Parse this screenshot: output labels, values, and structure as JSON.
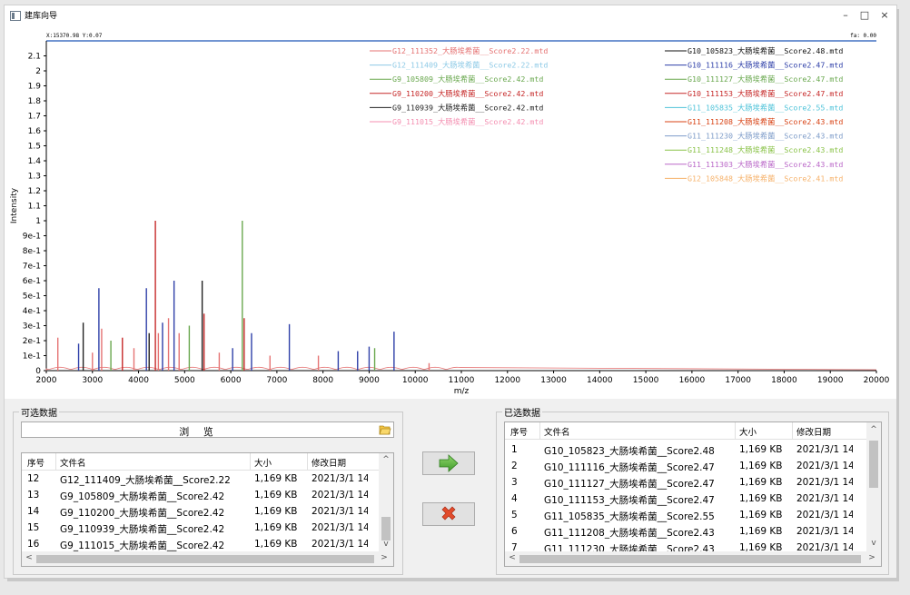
{
  "window": {
    "title": "建库向导",
    "minimize": "–",
    "maximize": "□",
    "close": "×"
  },
  "plot": {
    "cursor_readout": "X:15370.98 Y:0.07",
    "fa_readout": "fa: 0.00",
    "xlabel": "m/z",
    "ylabel": "Intensity",
    "colors": {
      "blue": "#2e3fa8",
      "red": "#c62828",
      "pink": "#e57373",
      "green": "#6aa84f",
      "black": "#222222",
      "axis": "#4472c4"
    }
  },
  "chart_data": {
    "type": "line",
    "title": "",
    "xlabel": "m/z",
    "ylabel": "Intensity",
    "xlim": [
      2000,
      20000
    ],
    "ylim": [
      0,
      2.2
    ],
    "x_ticks": [
      "2000",
      "3000",
      "4000",
      "5000",
      "6000",
      "7000",
      "8000",
      "9000",
      "10000",
      "11000",
      "12000",
      "13000",
      "14000",
      "15000",
      "16000",
      "17000",
      "18000",
      "19000",
      "20000"
    ],
    "y_ticks": [
      "0",
      "1e-1",
      "2e-1",
      "3e-1",
      "4e-1",
      "5e-1",
      "6e-1",
      "7e-1",
      "8e-1",
      "9e-1",
      "1",
      "1.1",
      "1.2",
      "1.3",
      "1.4",
      "1.5",
      "1.6",
      "1.7",
      "1.8",
      "1.9",
      "2",
      "2.1"
    ],
    "legend_placement": "top-right",
    "legend_left": [
      {
        "name": "G12_111352_大肠埃希菌__Score2.22.mtd",
        "color": "#e57373"
      },
      {
        "name": "G12_111409_大肠埃希菌__Score2.22.mtd",
        "color": "#8ecae6"
      },
      {
        "name": "G9_105809_大肠埃希菌__Score2.42.mtd",
        "color": "#6aa84f"
      },
      {
        "name": "G9_110200_大肠埃希菌__Score2.42.mtd",
        "color": "#c62828"
      },
      {
        "name": "G9_110939_大肠埃希菌__Score2.42.mtd",
        "color": "#222222"
      },
      {
        "name": "G9_111015_大肠埃希菌__Score2.42.mtd",
        "color": "#f48fb1"
      }
    ],
    "legend_right": [
      {
        "name": "G10_105823_大肠埃希菌__Score2.48.mtd",
        "color": "#111111"
      },
      {
        "name": "G10_111116_大肠埃希菌__Score2.47.mtd",
        "color": "#2e3fa8"
      },
      {
        "name": "G10_111127_大肠埃希菌__Score2.47.mtd",
        "color": "#6aa84f"
      },
      {
        "name": "G10_111153_大肠埃希菌__Score2.47.mtd",
        "color": "#c62828"
      },
      {
        "name": "G11_105835_大肠埃希菌__Score2.55.mtd",
        "color": "#4fc3d9"
      },
      {
        "name": "G11_111208_大肠埃希菌__Score2.43.mtd",
        "color": "#d84315"
      },
      {
        "name": "G11_111230_大肠埃希菌__Score2.43.mtd",
        "color": "#7e9cc9"
      },
      {
        "name": "G11_111248_大肠埃希菌__Score2.43.mtd",
        "color": "#8bc34a"
      },
      {
        "name": "G11_111303_大肠埃希菌__Score2.43.mtd",
        "color": "#ba68c8"
      },
      {
        "name": "G12_105848_大肠埃希菌__Score2.41.mtd",
        "color": "#f6b26b"
      }
    ],
    "peaks": [
      {
        "x": 2250,
        "y": 0.22,
        "color": "#e57373"
      },
      {
        "x": 2700,
        "y": 0.18,
        "color": "#2e3fa8"
      },
      {
        "x": 2800,
        "y": 0.32,
        "color": "#222222"
      },
      {
        "x": 3000,
        "y": 0.12,
        "color": "#e57373"
      },
      {
        "x": 3140,
        "y": 0.55,
        "color": "#2e3fa8"
      },
      {
        "x": 3200,
        "y": 0.28,
        "color": "#e57373"
      },
      {
        "x": 3400,
        "y": 0.2,
        "color": "#6aa84f"
      },
      {
        "x": 3650,
        "y": 0.22,
        "color": "#c62828"
      },
      {
        "x": 3900,
        "y": 0.15,
        "color": "#e57373"
      },
      {
        "x": 4170,
        "y": 0.55,
        "color": "#2e3fa8"
      },
      {
        "x": 4230,
        "y": 0.25,
        "color": "#222222"
      },
      {
        "x": 4365,
        "y": 1.0,
        "color": "#c62828"
      },
      {
        "x": 4430,
        "y": 0.25,
        "color": "#e57373"
      },
      {
        "x": 4520,
        "y": 0.32,
        "color": "#2e3fa8"
      },
      {
        "x": 4650,
        "y": 0.35,
        "color": "#e57373"
      },
      {
        "x": 4770,
        "y": 0.6,
        "color": "#2e3fa8"
      },
      {
        "x": 4880,
        "y": 0.25,
        "color": "#e57373"
      },
      {
        "x": 5100,
        "y": 0.3,
        "color": "#6aa84f"
      },
      {
        "x": 5380,
        "y": 0.6,
        "color": "#222222"
      },
      {
        "x": 5420,
        "y": 0.38,
        "color": "#c62828"
      },
      {
        "x": 5750,
        "y": 0.12,
        "color": "#e57373"
      },
      {
        "x": 6040,
        "y": 0.15,
        "color": "#2e3fa8"
      },
      {
        "x": 6250,
        "y": 1.0,
        "color": "#6aa84f"
      },
      {
        "x": 6290,
        "y": 0.35,
        "color": "#c62828"
      },
      {
        "x": 6450,
        "y": 0.25,
        "color": "#2e3fa8"
      },
      {
        "x": 6850,
        "y": 0.1,
        "color": "#e57373"
      },
      {
        "x": 7270,
        "y": 0.31,
        "color": "#2e3fa8"
      },
      {
        "x": 7900,
        "y": 0.1,
        "color": "#e57373"
      },
      {
        "x": 8330,
        "y": 0.13,
        "color": "#2e3fa8"
      },
      {
        "x": 8750,
        "y": 0.13,
        "color": "#2e3fa8"
      },
      {
        "x": 9000,
        "y": 0.16,
        "color": "#2e3fa8"
      },
      {
        "x": 9120,
        "y": 0.15,
        "color": "#6aa84f"
      },
      {
        "x": 9540,
        "y": 0.26,
        "color": "#2e3fa8"
      },
      {
        "x": 10300,
        "y": 0.05,
        "color": "#e57373"
      }
    ]
  },
  "left_panel": {
    "title": "可选数据",
    "browse_label": "浏 览",
    "headers": {
      "idx": "序号",
      "name": "文件名",
      "size": "大小",
      "date": "修改日期"
    },
    "rows": [
      {
        "idx": "12",
        "name": "G12_111409_大肠埃希菌__Score2.22",
        "size": "1,169 KB",
        "date": "2021/3/1 14:..."
      },
      {
        "idx": "13",
        "name": "G9_105809_大肠埃希菌__Score2.42",
        "size": "1,169 KB",
        "date": "2021/3/1 14:..."
      },
      {
        "idx": "14",
        "name": "G9_110200_大肠埃希菌__Score2.42",
        "size": "1,169 KB",
        "date": "2021/3/1 14:..."
      },
      {
        "idx": "15",
        "name": "G9_110939_大肠埃希菌__Score2.42",
        "size": "1,169 KB",
        "date": "2021/3/1 14:..."
      },
      {
        "idx": "16",
        "name": "G9_111015_大肠埃希菌__Score2.42",
        "size": "1,169 KB",
        "date": "2021/3/1 14:..."
      }
    ]
  },
  "right_panel": {
    "title": "已选数据",
    "headers": {
      "idx": "序号",
      "name": "文件名",
      "size": "大小",
      "date": "修改日期"
    },
    "rows": [
      {
        "idx": "1",
        "name": "G10_105823_大肠埃希菌__Score2.48",
        "size": "1,169 KB",
        "date": "2021/3/1 14:..."
      },
      {
        "idx": "2",
        "name": "G10_111116_大肠埃希菌__Score2.47",
        "size": "1,169 KB",
        "date": "2021/3/1 14:..."
      },
      {
        "idx": "3",
        "name": "G10_111127_大肠埃希菌__Score2.47",
        "size": "1,169 KB",
        "date": "2021/3/1 14:..."
      },
      {
        "idx": "4",
        "name": "G10_111153_大肠埃希菌__Score2.47",
        "size": "1,169 KB",
        "date": "2021/3/1 14:..."
      },
      {
        "idx": "5",
        "name": "G11_105835_大肠埃希菌__Score2.55",
        "size": "1,169 KB",
        "date": "2021/3/1 14:..."
      },
      {
        "idx": "6",
        "name": "G11_111208_大肠埃希菌__Score2.43",
        "size": "1,169 KB",
        "date": "2021/3/1 14:..."
      },
      {
        "idx": "7",
        "name": "G11_111230_大肠埃希菌__Score2.43",
        "size": "1,169 KB",
        "date": "2021/3/1 14:..."
      }
    ]
  },
  "buttons": {
    "add_icon": "right-arrow-icon",
    "remove_icon": "red-x-icon"
  },
  "scroll": {
    "up": "^",
    "down": "v",
    "left": "<",
    "right": ">"
  }
}
